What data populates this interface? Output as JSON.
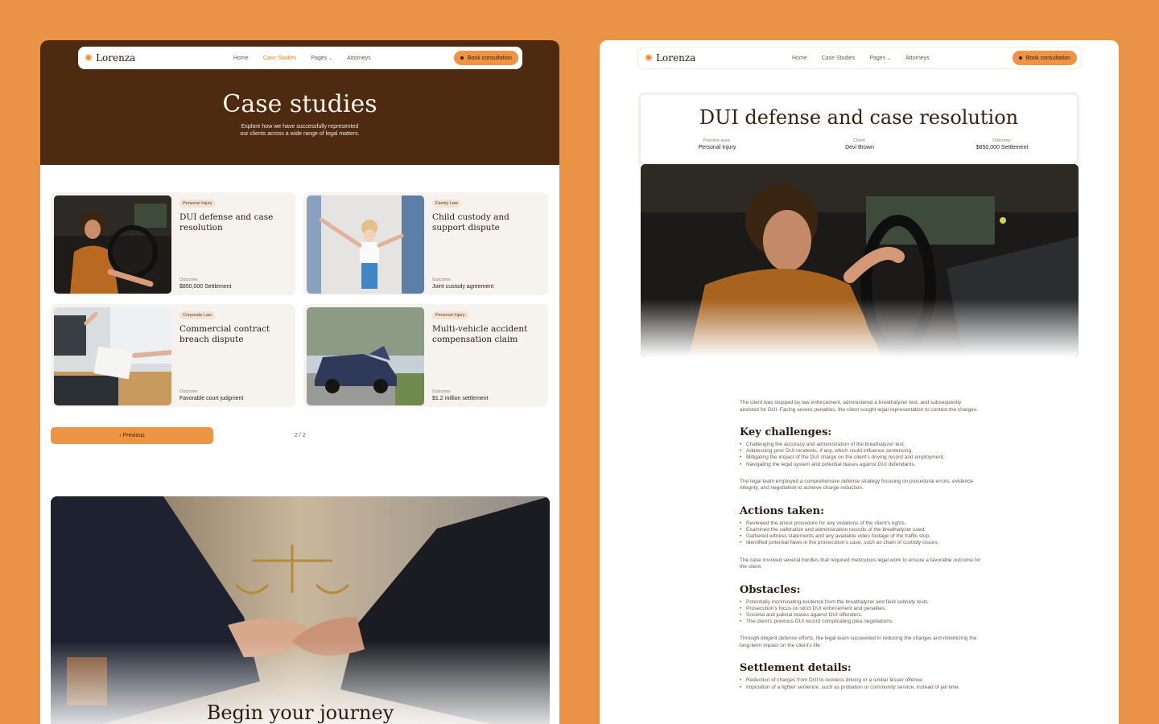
{
  "brand": {
    "name": "Lorenza"
  },
  "nav": {
    "links": [
      "Home",
      "Case Studies",
      "Pages",
      "Attorneys"
    ],
    "book_label": "Book consultation"
  },
  "left": {
    "hero_title": "Case studies",
    "hero_sub_line1": "Explore how we have successfully represented",
    "hero_sub_line2": "our clients across a wide range of legal matters.",
    "cards": [
      {
        "tag": "Personal Injury",
        "title": "DUI defense and case resolution",
        "outcome_label": "Outcome:",
        "outcome": "$850,000 Settlement"
      },
      {
        "tag": "Family Law",
        "title": "Child custody and support dispute",
        "outcome_label": "Outcome:",
        "outcome": "Joint custody agreement"
      },
      {
        "tag": "Corporate Law",
        "title": "Commercial contract breach dispute",
        "outcome_label": "Outcome:",
        "outcome": "Favorable court judgment"
      },
      {
        "tag": "Personal Injury",
        "title": "Multi-vehicle accident compensation claim",
        "outcome_label": "Outcome:",
        "outcome": "$1.2 million settlement"
      }
    ],
    "prev_label": "‹ Previous",
    "pager": "2 / 2",
    "banner_title": "Begin your journey"
  },
  "right": {
    "title": "DUI defense and case resolution",
    "meta": [
      {
        "label": "Practice area:",
        "value": "Personal Injury"
      },
      {
        "label": "Client:",
        "value": "Devi Brown"
      },
      {
        "label": "Outcome:",
        "value": "$850,000 Settlement"
      }
    ],
    "intro": "The client was stopped by law enforcement, administered a breathalyzer test, and subsequently arrested for DUI. Facing severe penalties, the client sought legal representation to contest the charges.",
    "sections": [
      {
        "heading": "Key challenges:",
        "items": [
          "Challenging the accuracy and administration of the breathalyzer test.",
          "Addressing prior DUI incidents, if any, which could influence sentencing.",
          "Mitigating the impact of the DUI charge on the client's driving record and employment.",
          "Navigating the legal system and potential biases against DUI defendants."
        ],
        "after": "The legal team employed a comprehensive defense strategy focusing on procedural errors, evidence integrity, and negotiation to achieve charge reduction."
      },
      {
        "heading": "Actions taken:",
        "items": [
          "Reviewed the arrest procedure for any violations of the client's rights.",
          "Examined the calibration and administration records of the breathalyzer used.",
          "Gathered witness statements and any available video footage of the traffic stop.",
          "Identified potential flaws in the prosecution's case, such as chain of custody issues."
        ],
        "after": "The case involved several hurdles that required meticulous legal work to ensure a favorable outcome for the client."
      },
      {
        "heading": "Obstacles:",
        "items": [
          "Potentially incriminating evidence from the breathalyzer and field sobriety tests.",
          "Prosecution's focus on strict DUI enforcement and penalties.",
          "Societal and judicial biases against DUI offenders.",
          "The client's previous DUI record complicating plea negotiations."
        ],
        "after": "Through diligent defense efforts, the legal team succeeded in reducing the charges and minimizing the long-term impact on the client's life."
      },
      {
        "heading": "Settlement details:",
        "items": [
          "Reduction of charges from DUI to reckless driving or a similar lesser offense.",
          "Imposition of a lighter sentence, such as probation or community service, instead of jail time."
        ],
        "after": ""
      }
    ]
  },
  "colors": {
    "accent": "#ee9445",
    "hero_brown": "#4d2a10",
    "background": "#ea9347"
  }
}
